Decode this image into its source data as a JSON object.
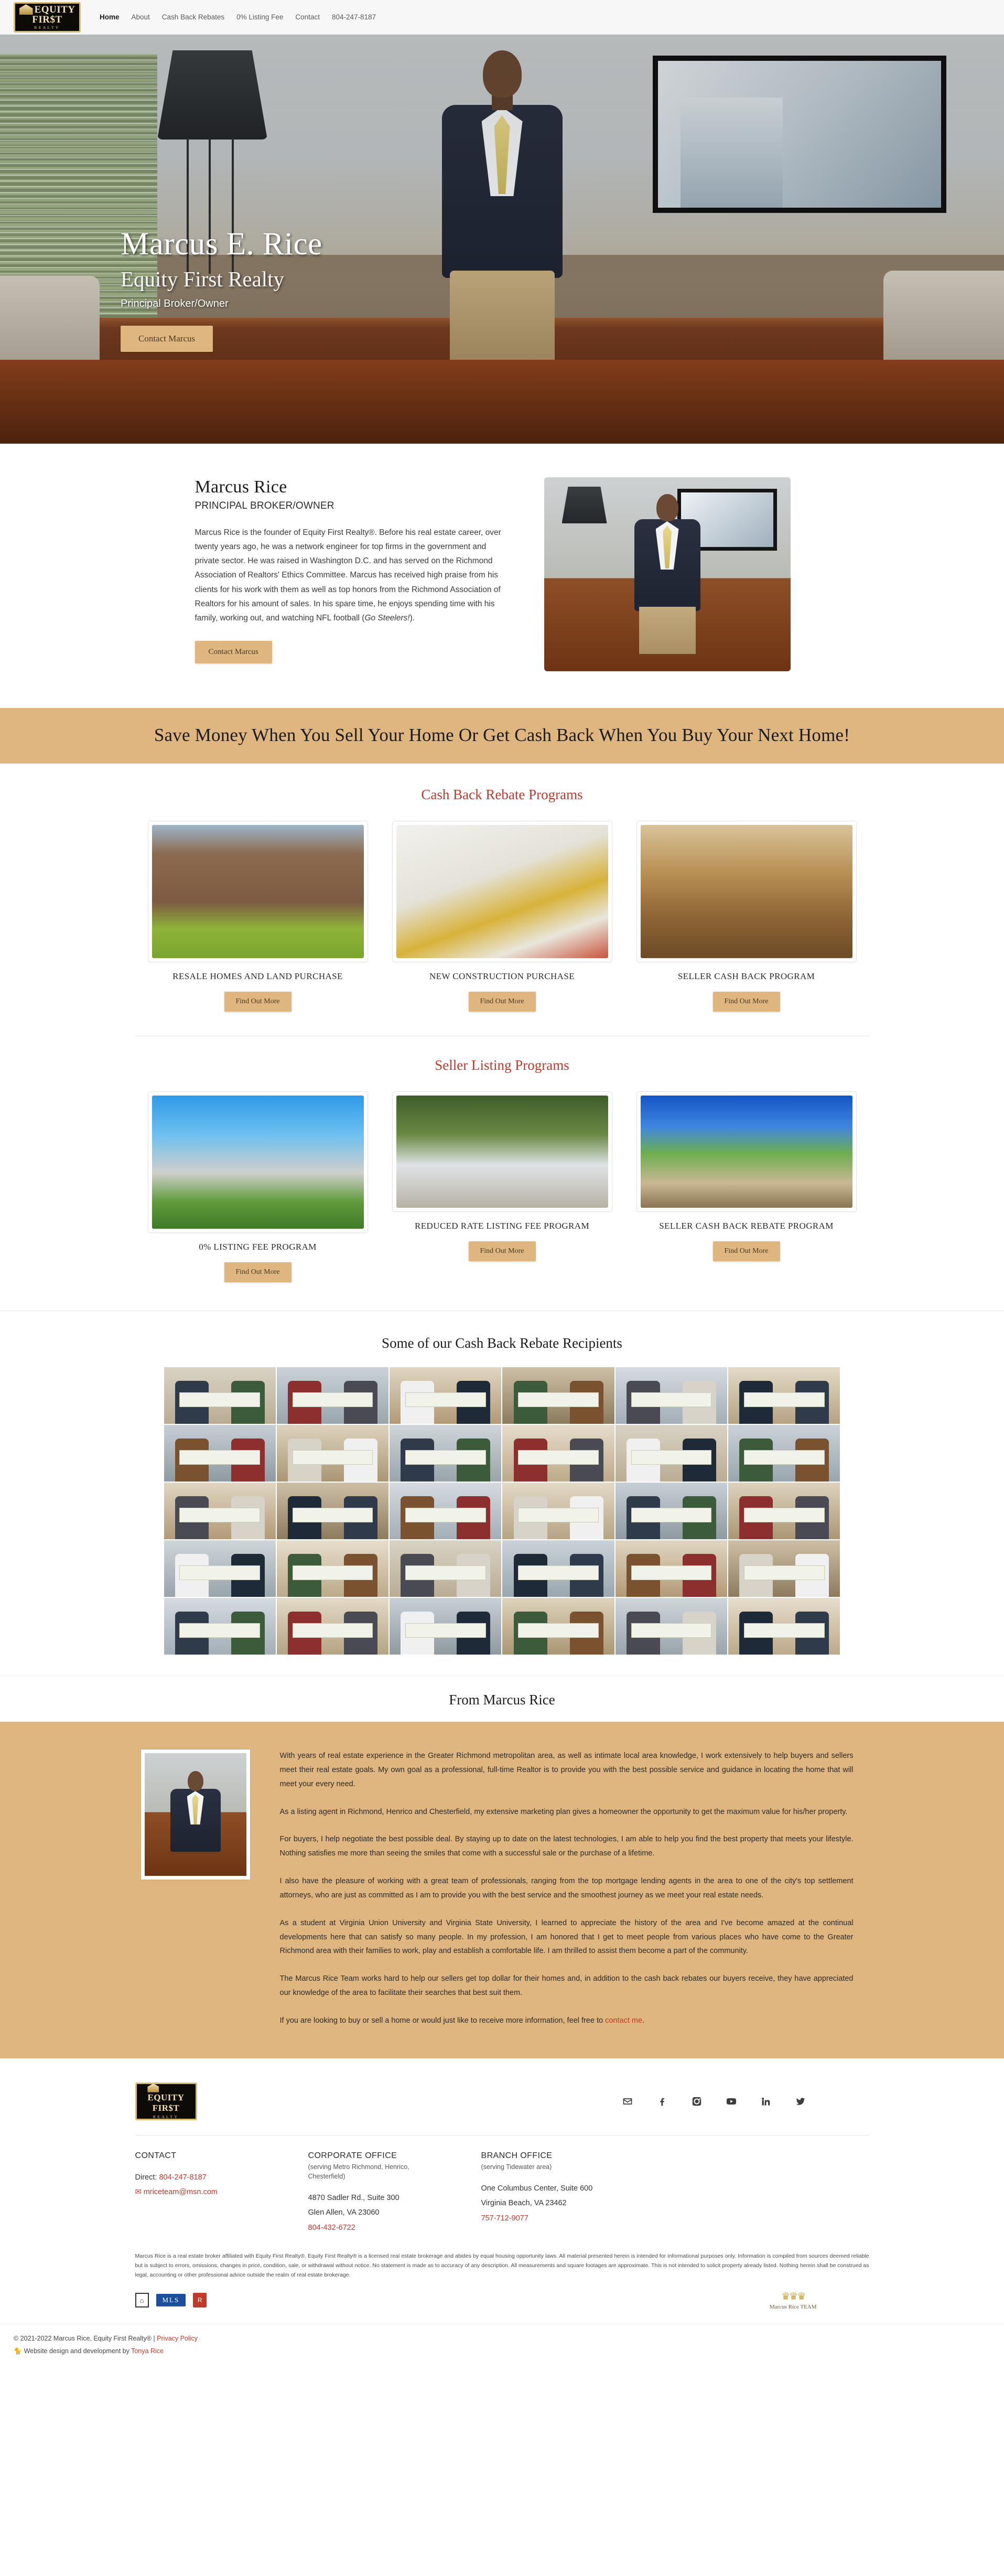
{
  "brand": {
    "logo_line1": "EQUITY",
    "logo_line2": "FIR$T",
    "logo_line3": "REALTY"
  },
  "nav": {
    "items": [
      {
        "label": "Home",
        "active": true
      },
      {
        "label": "About",
        "active": false
      },
      {
        "label": "Cash Back Rebates",
        "active": false
      },
      {
        "label": "0% Listing Fee",
        "active": false
      },
      {
        "label": "Contact",
        "active": false
      },
      {
        "label": "804-247-8187",
        "active": false
      }
    ]
  },
  "hero": {
    "title": "Marcus E. Rice",
    "subtitle": "Equity First Realty",
    "role": "Principal Broker/Owner",
    "cta": "Contact Marcus"
  },
  "about": {
    "name": "Marcus Rice",
    "role": "PRINCIPAL BROKER/OWNER",
    "bio_part1": "Marcus Rice is the founder of Equity First Realty®. Before his real estate career, over twenty years ago, he was a network engineer for top firms in the government and private sector. He was raised in Washington D.C. and has served on the Richmond Association of Realtors' Ethics Committee. Marcus has received high praise from his clients for his work with them as well as top honors from the Richmond Association of Realtors for his amount of sales. In his spare time, he enjoys spending time with his family, working out, and watching NFL football (",
    "bio_italic": "Go Steelers!",
    "bio_part2": ").",
    "cta": "Contact Marcus"
  },
  "banner": {
    "headline": "Save Money When You Sell Your Home Or Get Cash Back When You Buy Your Next Home!"
  },
  "cashback": {
    "section_title": "Cash Back Rebate Programs",
    "cards": [
      {
        "label": "RESALE HOMES AND LAND PURCHASE",
        "cta": "Find Out More",
        "img_class": "img-resale"
      },
      {
        "label": "NEW CONSTRUCTION PURCHASE",
        "cta": "Find Out More",
        "img_class": "img-newcon"
      },
      {
        "label": "SELLER CASH BACK PROGRAM",
        "cta": "Find Out More",
        "img_class": "img-sellercb"
      }
    ]
  },
  "seller_listing": {
    "section_title": "Seller Listing Programs",
    "cards": [
      {
        "label": "0% LISTING FEE PROGRAM",
        "cta": "Find Out More",
        "img_class": "img-zero"
      },
      {
        "label": "REDUCED RATE LISTING FEE PROGRAM",
        "cta": "Find Out More",
        "img_class": "img-reduced"
      },
      {
        "label": "SELLER CASH BACK REBATE PROGRAM",
        "cta": "Find Out More",
        "img_class": "img-sellerrebate"
      }
    ]
  },
  "recipients": {
    "title": "Some of our Cash Back Rebate Recipients"
  },
  "from_marcus": {
    "title": "From Marcus Rice",
    "paragraphs": [
      "With years of real estate experience in the Greater Richmond metropolitan area, as well as intimate local area knowledge, I work extensively to help buyers and sellers meet their real estate goals. My own goal as a professional, full-time Realtor is to provide you with the best possible service and guidance in locating the home that will meet your every need.",
      "As a listing agent in Richmond, Henrico and Chesterfield, my extensive marketing plan gives a homeowner the opportunity to get the maximum value for his/her property.",
      "For buyers, I help negotiate the best possible deal. By staying up to date on the latest technologies, I am able to help you find the best property that meets your lifestyle. Nothing satisfies me more than seeing the smiles that come with a successful sale or the purchase of a lifetime.",
      "I also have the pleasure of working with a great team of professionals, ranging from the top mortgage lending agents in the area to one of the city's top settlement attorneys, who are just as committed as I am to provide you with the best service and the smoothest journey as we meet your real estate needs.",
      "As a student at Virginia Union University and Virginia State University, I learned to appreciate the history of the area and I've become amazed at the continual developments here that can satisfy so many people. In my profession, I am honored that I get to meet people from various places who have come to the Greater Richmond area with their families to work, play and establish a comfortable life. I am thrilled to assist them become a part of the community.",
      "The Marcus Rice Team works hard to help our sellers get top dollar for their homes and, in addition to the cash back rebates our buyers receive, they have appreciated our knowledge of the area to facilitate their searches that best suit them."
    ],
    "closing_pre": "If you are looking to buy or sell a home or would just like to receive more information, feel free to ",
    "closing_link": "contact me",
    "closing_post": "."
  },
  "footer": {
    "social": [
      {
        "name": "email-icon"
      },
      {
        "name": "facebook-icon"
      },
      {
        "name": "instagram-icon"
      },
      {
        "name": "youtube-icon"
      },
      {
        "name": "linkedin-icon"
      },
      {
        "name": "twitter-icon"
      }
    ],
    "contact": {
      "heading": "CONTACT",
      "direct_label": "Direct:",
      "direct_phone": "804-247-8187",
      "email": "mriceteam@msn.com"
    },
    "corporate": {
      "heading": "CORPORATE OFFICE",
      "serving": "(serving Metro Richmond, Henrico, Chesterfield)",
      "address1": "4870 Sadler Rd., Suite 300",
      "address2": "Glen Allen, VA 23060",
      "phone": "804-432-6722"
    },
    "branch": {
      "heading": "BRANCH OFFICE",
      "serving": "(serving Tidewater area)",
      "address1": "One Columbus Center, Suite 600",
      "address2": "Virginia Beach, VA 23462",
      "phone": "757-712-9077"
    },
    "disclaimer": "Marcus Rice is a real estate broker affiliated with Equity First Realty®. Equity First Realty® is a licensed real estate brokerage and abides by equal housing opportunity laws. All material presented herein is intended for informational purposes only. Information is compiled from sources deemed reliable but is subject to errors, omissions, changes in price, condition, sale, or withdrawal without notice. No statement is made as to accuracy of any description. All measurements and square footages are approximate. This is not intended to solicit property already listed. Nothing herein shall be construed as legal, accounting or other professional advice outside the realm of real estate brokerage.",
    "badges": {
      "eho": "EHO",
      "mls": "MLS",
      "realtor": "R"
    },
    "team_logo_name": "Marcus Rice TEAM",
    "copyright": "© 2021-2022 Marcus Rice, Equity First Realty® |",
    "privacy_link": "Privacy Policy",
    "credit_pre": "Website design and development by",
    "credit_link": "Tonya Rice"
  }
}
